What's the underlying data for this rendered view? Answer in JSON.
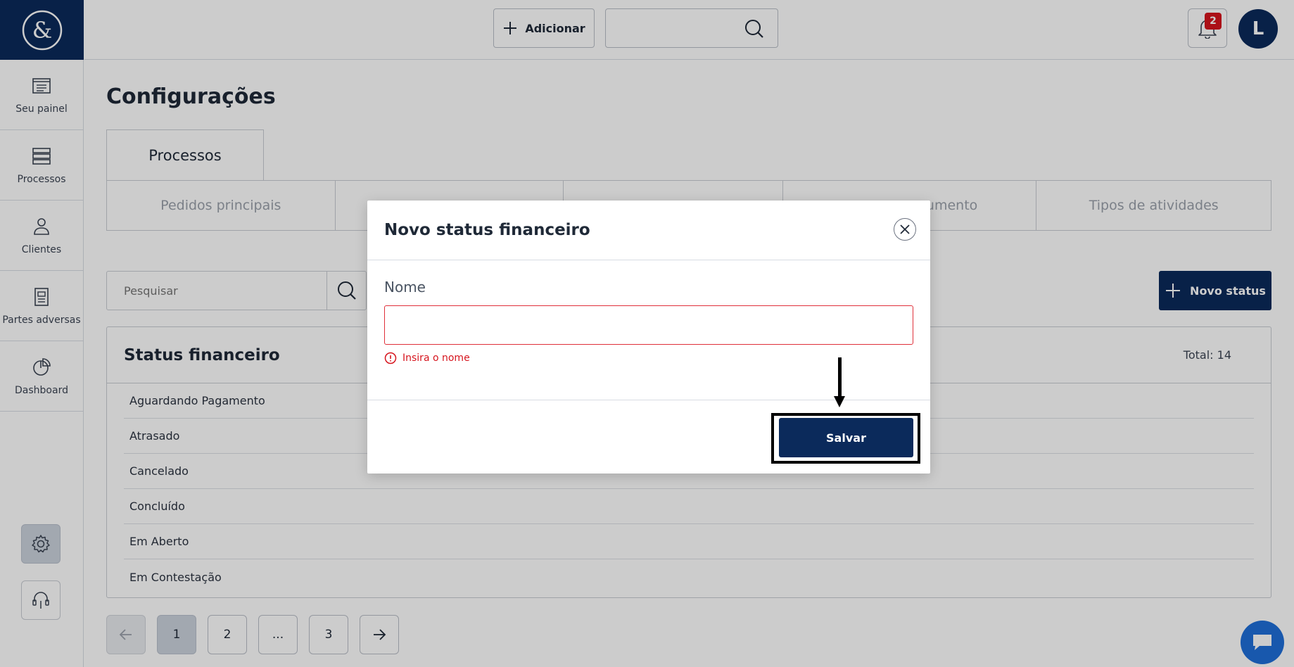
{
  "sidebar": {
    "items": [
      {
        "label": "Seu painel",
        "icon": "dashboard-list-icon"
      },
      {
        "label": "Processos",
        "icon": "stack-icon"
      },
      {
        "label": "Clientes",
        "icon": "user-icon"
      },
      {
        "label": "Partes adversas",
        "icon": "document-icon"
      },
      {
        "label": "Dashboard",
        "icon": "pie-chart-icon"
      }
    ],
    "settings_icon": "gear-icon",
    "support_icon": "headset-icon"
  },
  "topbar": {
    "add_label": "Adicionar",
    "search_placeholder": "",
    "notification_count": "2",
    "avatar_initial": "L"
  },
  "page": {
    "title": "Configurações",
    "main_tab": "Processos",
    "subtabs": [
      "Pedidos principais",
      "",
      "",
      "umento",
      "Tipos de atividades"
    ],
    "filter_placeholder": "Pesquisar",
    "new_status_label": "Novo status"
  },
  "panel": {
    "title": "Status financeiro",
    "total": "Total: 14",
    "rows": [
      "Aguardando Pagamento",
      "Atrasado",
      "Cancelado",
      "Concluído",
      "Em Aberto",
      "Em Contestação"
    ]
  },
  "pagination": {
    "pages": [
      "1",
      "2",
      "...",
      "3"
    ]
  },
  "modal": {
    "title": "Novo status financeiro",
    "field_label": "Nome",
    "field_value": "",
    "error": "Insira o nome",
    "save_label": "Salvar"
  },
  "colors": {
    "brand": "#0b2a5b",
    "error": "#d6141d",
    "chat": "#1e6fd9"
  }
}
